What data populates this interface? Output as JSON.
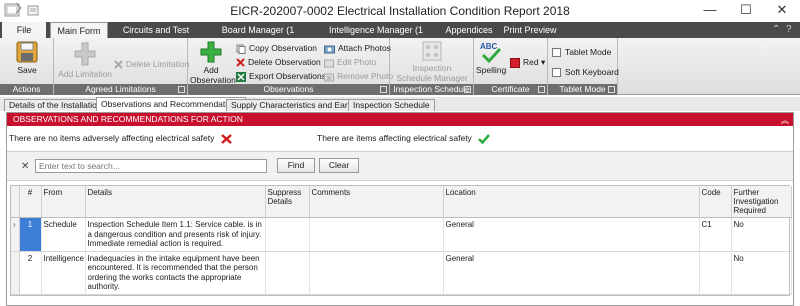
{
  "window": {
    "title": "EICR-202007-0002 Electrical Installation Condition Report 2018",
    "controls": {
      "minimize": "—",
      "maximize": "☐",
      "close": "✕"
    }
  },
  "ribbon_tabs": [
    "File",
    "Main Form",
    "Circuits and Test Results",
    "Board Manager (1 Board)",
    "Intelligence Manager (1 Statement)",
    "Appendices",
    "Print Preview"
  ],
  "ribbon_helpers": {
    "collapse": "⌃",
    "help": "?"
  },
  "ribbon": {
    "actions": {
      "label": "Actions",
      "save": "Save"
    },
    "agreed_limitations": {
      "label": "Agreed Limitations",
      "add": "Add Limitation",
      "delete": "Delete Limitation"
    },
    "observations": {
      "label": "Observations",
      "add_line1": "Add",
      "add_line2": "Observation",
      "copy": "Copy Observation",
      "delete": "Delete Observation",
      "export": "Export Observations",
      "attach": "Attach Photos",
      "edit": "Edit Photo",
      "remove": "Remove Photo"
    },
    "inspection_schedule": {
      "label": "Inspection Schedule",
      "manager_line1": "Inspection",
      "manager_line2": "Schedule Manager"
    },
    "certificate": {
      "label": "Certificate",
      "spelling": "Spelling",
      "color": "Red",
      "color_hex": "#d4202a"
    },
    "tablet_mode": {
      "label": "Tablet Mode",
      "tablet": "Tablet Mode",
      "soft_keyboard": "Soft Keyboard"
    }
  },
  "doc_tabs": [
    "Details of the Installation",
    "Observations and Recommendations",
    "Supply Characteristics and Earthing",
    "Inspection Schedule"
  ],
  "panel": {
    "header": "OBSERVATIONS AND RECOMMENDATIONS FOR ACTION",
    "collapse": "︽",
    "status_no_items": "There are no items adversely affecting electrical safety",
    "status_items": "There are items affecting electrical safety",
    "search": {
      "clear_x": "✕",
      "placeholder": "Enter text to search...",
      "find": "Find",
      "clear": "Clear"
    }
  },
  "table": {
    "columns": [
      "#",
      "From",
      "Details",
      "Suppress Details",
      "Comments",
      "Location",
      "Code",
      "Further Investigation Required"
    ],
    "rows": [
      {
        "num": "1",
        "from": "Schedule",
        "details": "Inspection Schedule Item 1.1: Service cable. is in a dangerous condition and presents risk of injury. Immediate remedial action is required.",
        "suppress": "",
        "comments": "",
        "location": "General",
        "code": "C1",
        "further": "No"
      },
      {
        "num": "2",
        "from": "Intelligence",
        "details": "Inadequacies in the intake equipment have been encountered.  It is recommended that the person ordering the works contacts the appropriate authority.",
        "suppress": "",
        "comments": "",
        "location": "General",
        "code": "",
        "further": "No"
      }
    ]
  },
  "colors": {
    "accent_red": "#c8102e",
    "ribbon_dark": "#4a4a4a",
    "selection": "#3d7ed6"
  }
}
